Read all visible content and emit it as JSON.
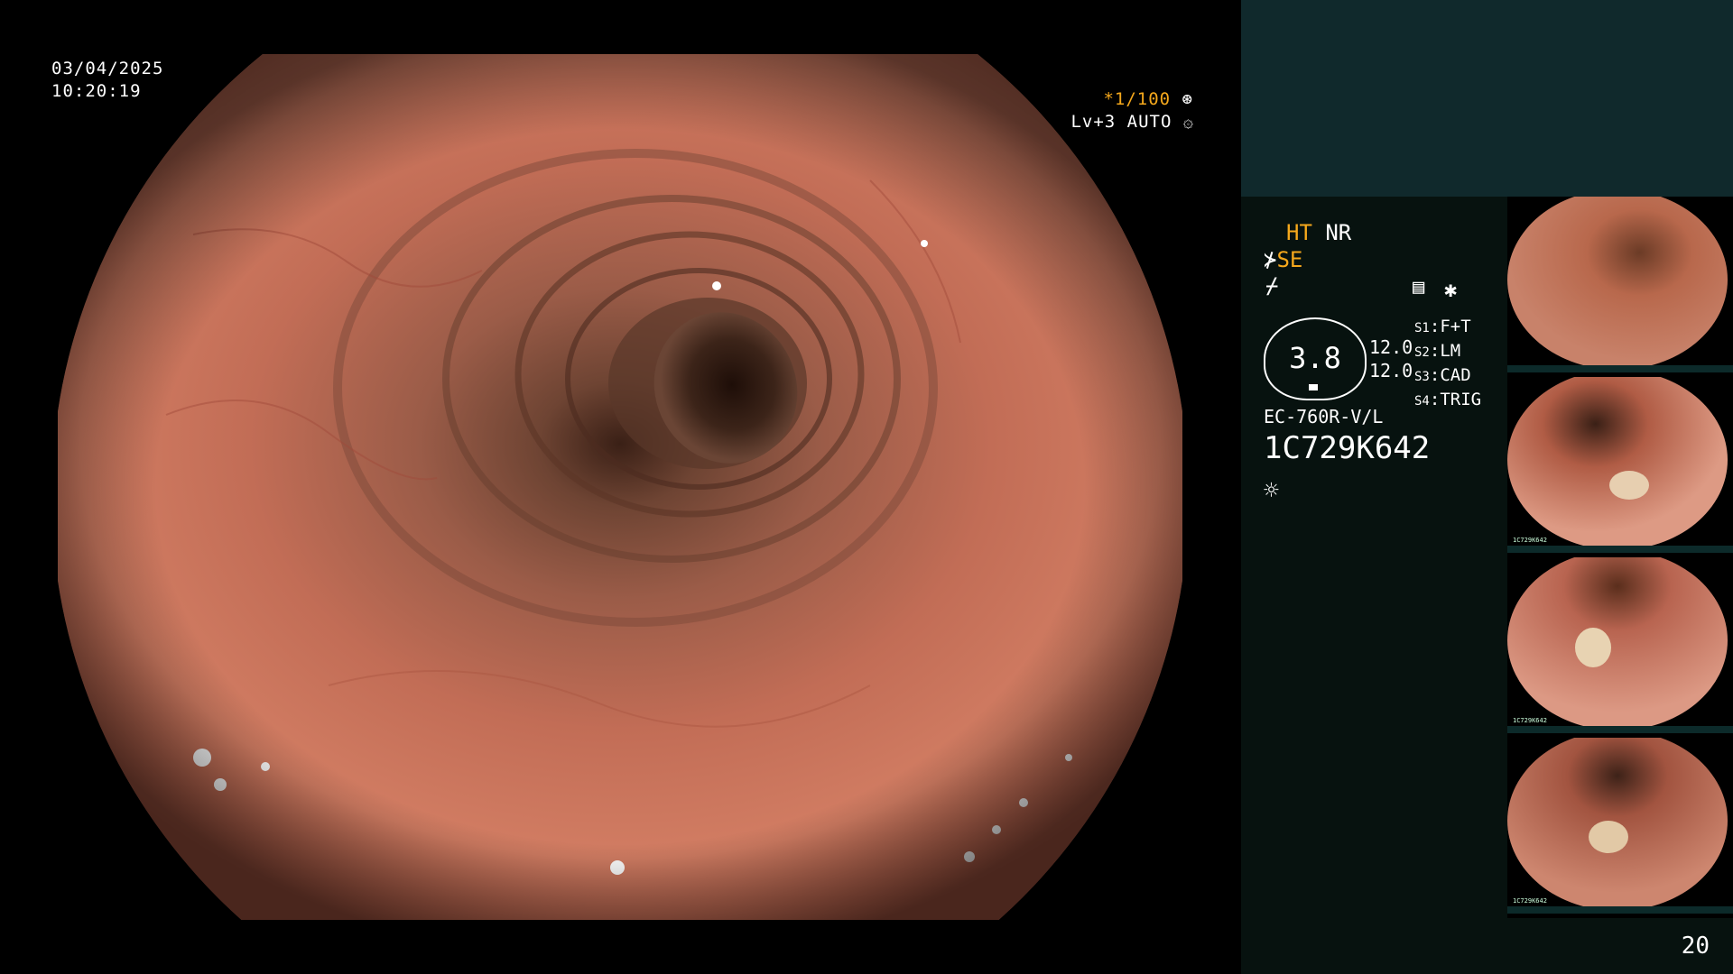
{
  "scope_view": {
    "date": "03/04/2025",
    "time": "10:20:19",
    "shutter": "*1/100",
    "level_mode": "Lv+3 AUTO"
  },
  "panel": {
    "ht": "HT",
    "nr": "NR",
    "se": "SE",
    "zoom_value": "3.8",
    "values": [
      "12.0",
      "12.0"
    ],
    "s_labels": [
      {
        "key": "S1",
        "val": "F+T"
      },
      {
        "key": "S2",
        "val": "LM"
      },
      {
        "key": "S3",
        "val": "CAD"
      },
      {
        "key": "S4",
        "val": "TRIG"
      }
    ],
    "scope_model": "EC-760R-V/L",
    "serial": "1C729K642",
    "page_number": "20"
  },
  "thumbnails": [
    {
      "id": "1C729K642"
    },
    {
      "id": "1C729K642"
    },
    {
      "id": "1C729K642"
    },
    {
      "id": "1C729K642"
    }
  ],
  "colors": {
    "accent": "#f5a81c",
    "panel_top": "#10292c",
    "panel_bg": "#07120f",
    "mucosa": "#c9735a"
  },
  "icons": [
    "star-symbol-icon",
    "settings-icon",
    "scissors-icon",
    "lightning-icon",
    "document-icon",
    "asterisk-icon",
    "light-icon",
    "scope-tip-icon"
  ]
}
